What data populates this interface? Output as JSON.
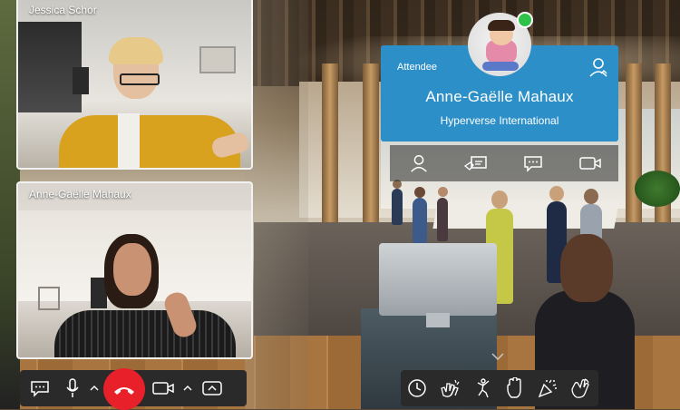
{
  "participants": [
    {
      "name": "Jessica Schor"
    },
    {
      "name": "Anne-Gaëlle Mahaux"
    }
  ],
  "attendee_card": {
    "role": "Attendee",
    "name": "Anne-Gaëlle Mahaux",
    "organization": "Hyperverse International",
    "status": "online",
    "actions": [
      "profile-icon",
      "business-card-icon",
      "chat-icon",
      "video-icon"
    ]
  },
  "call_controls": {
    "items": [
      "chat-icon",
      "microphone-icon",
      "chevron-up-icon",
      "hang-up-icon",
      "camera-icon",
      "chevron-up-icon",
      "expand-icon"
    ],
    "hangup_color": "#e8202a"
  },
  "reactions": {
    "items": [
      "clock-icon",
      "clapping-hands-icon",
      "dancing-icon",
      "raise-hand-icon",
      "party-popper-icon",
      "waving-hand-icon"
    ]
  },
  "colors": {
    "card_background": "#2d8fc8",
    "online": "#2ec248",
    "toolbar": "#2a2a2a"
  }
}
